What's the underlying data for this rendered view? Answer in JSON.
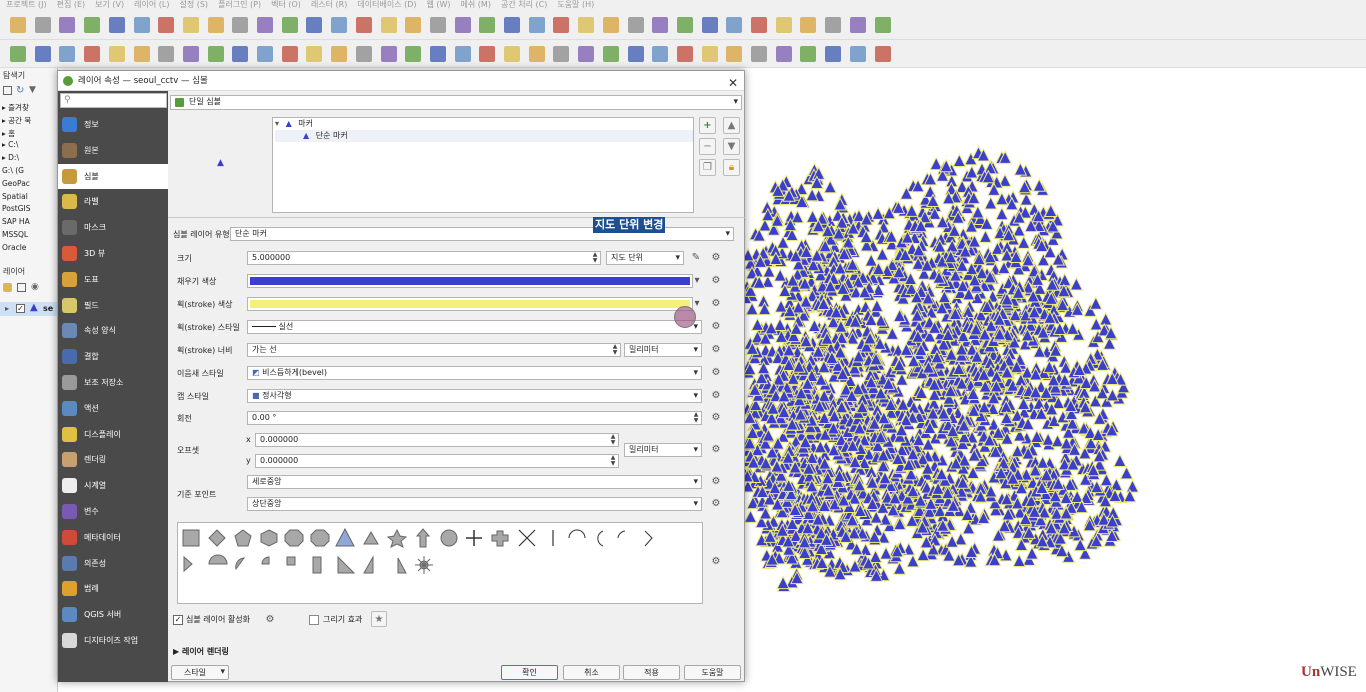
{
  "menu": [
    "프로젝트 (J)",
    "편집 (E)",
    "보기 (V)",
    "레이어 (L)",
    "설정 (S)",
    "플러그인 (P)",
    "벡터 (O)",
    "래스터 (R)",
    "데이터베이스 (D)",
    "웹 (W)",
    "메쉬 (M)",
    "공간 처리 (C)",
    "도움말 (H)"
  ],
  "browser_panel": {
    "title": "탐색기",
    "items": [
      "즐겨찾",
      "공간 북",
      "홈",
      "C:\\",
      "D:\\",
      "G:\\ (G",
      "GeoPac",
      "Spatial",
      "PostGIS",
      "SAP HA",
      "MSSQL",
      "Oracle"
    ]
  },
  "layers_panel": {
    "title": "레이어",
    "layer_name": "se"
  },
  "dialog": {
    "title": "레이어 속성 — seoul_cctv — 심볼",
    "close_glyph": "✕",
    "sidebar": [
      {
        "label": "정보",
        "color": "#3a7bd5"
      },
      {
        "label": "원본",
        "color": "#8b6e4e"
      },
      {
        "label": "심볼",
        "color": "#c49a3c"
      },
      {
        "label": "라벨",
        "color": "#d9b94a"
      },
      {
        "label": "마스크",
        "color": "#6a6a6a"
      },
      {
        "label": "3D 뷰",
        "color": "#d85a3a"
      },
      {
        "label": "도표",
        "color": "#d8a23a"
      },
      {
        "label": "필드",
        "color": "#d8c66a"
      },
      {
        "label": "속성 양식",
        "color": "#6a8ab5"
      },
      {
        "label": "결합",
        "color": "#4a6ab0"
      },
      {
        "label": "보조 저장소",
        "color": "#9a9a9a"
      },
      {
        "label": "액션",
        "color": "#5a8ac0"
      },
      {
        "label": "디스플레이",
        "color": "#e0c040"
      },
      {
        "label": "렌더링",
        "color": "#c8a070"
      },
      {
        "label": "시계열",
        "color": "#eeeeee"
      },
      {
        "label": "변수",
        "color": "#7a5ab0"
      },
      {
        "label": "메타데이터",
        "color": "#d04a3a"
      },
      {
        "label": "의존성",
        "color": "#5a7ab0"
      },
      {
        "label": "범례",
        "color": "#e0a030"
      },
      {
        "label": "QGIS 서버",
        "color": "#5a8ac0"
      },
      {
        "label": "디지타이즈 작업",
        "color": "#d8d8d8"
      }
    ],
    "renderer": "단일 심볼",
    "symbol_tree": {
      "root": "마커",
      "child": "단순 마커"
    },
    "symbol_layer_type_label": "심볼 레이어 유형",
    "symbol_layer_type": "단순 마커",
    "annotation": "지도 단위 변경",
    "props": {
      "size_label": "크기",
      "size_value": "5.000000",
      "size_unit": "지도 단위",
      "fill_label": "채우기 색상",
      "fill_color": "#3a3fd0",
      "stroke_color_label": "획(stroke) 색상",
      "stroke_color": "#f5f07a",
      "stroke_style_label": "획(stroke) 스타일",
      "stroke_style": "실선",
      "stroke_width_label": "획(stroke) 너비",
      "stroke_width": "가는 선",
      "stroke_width_unit": "밀리미터",
      "join_label": "이음새 스타일",
      "join_value": "비스듬하게(bevel)",
      "cap_label": "캡 스타일",
      "cap_value": "정사각형",
      "rotation_label": "회전",
      "rotation_value": "0.00 °",
      "offset_label": "오프셋",
      "offset_x_label": "x",
      "offset_x": "0.000000",
      "offset_y_label": "y",
      "offset_y": "0.000000",
      "offset_unit": "밀리미터",
      "anchor_label": "기준 포인트",
      "anchor_h": "세로중앙",
      "anchor_v": "상단중앙"
    },
    "enable_layer_label": "심볼 레이어 활성화",
    "draw_effects_label": "그리기 효과",
    "layer_rendering_label": "레이어 렌더링",
    "buttons": {
      "style": "스타일",
      "ok": "확인",
      "cancel": "취소",
      "apply": "적용",
      "help": "도움말"
    }
  },
  "watermark": "WISE"
}
